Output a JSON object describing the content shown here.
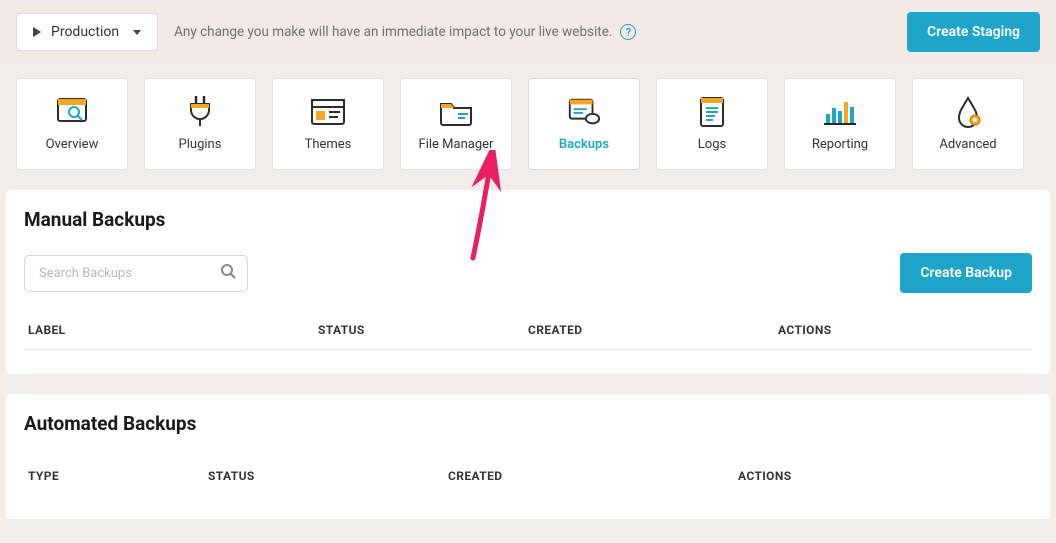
{
  "top_bar": {
    "environment_label": "Production",
    "message": "Any change you make will have an immediate impact to your live website.",
    "create_staging_label": "Create Staging"
  },
  "tabs": [
    {
      "key": "overview",
      "label": "Overview"
    },
    {
      "key": "plugins",
      "label": "Plugins"
    },
    {
      "key": "themes",
      "label": "Themes"
    },
    {
      "key": "file_manager",
      "label": "File Manager"
    },
    {
      "key": "backups",
      "label": "Backups"
    },
    {
      "key": "logs",
      "label": "Logs"
    },
    {
      "key": "reporting",
      "label": "Reporting"
    },
    {
      "key": "advanced",
      "label": "Advanced"
    }
  ],
  "active_tab": "backups",
  "manual_backups": {
    "title": "Manual Backups",
    "search_placeholder": "Search Backups",
    "create_backup_label": "Create Backup",
    "columns": {
      "label": "LABEL",
      "status": "STATUS",
      "created": "CREATED",
      "actions": "ACTIONS"
    },
    "rows": []
  },
  "automated_backups": {
    "title": "Automated Backups",
    "columns": {
      "type": "TYPE",
      "status": "STATUS",
      "created": "CREATED",
      "actions": "ACTIONS"
    },
    "rows": []
  },
  "colors": {
    "accent": "#1ea5c9",
    "bg": "#f4eeea",
    "arrow": "#e91e63",
    "icon_orange": "#f5a623",
    "icon_dark": "#2c2c2c",
    "icon_blue": "#1ea5c9"
  }
}
